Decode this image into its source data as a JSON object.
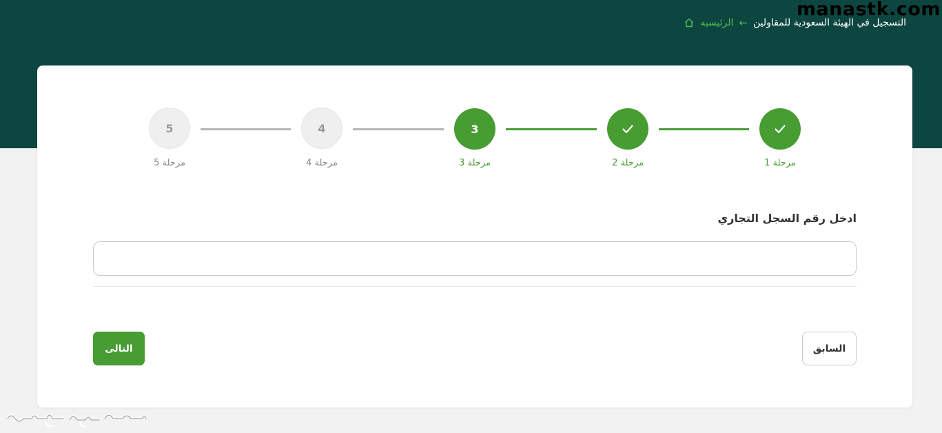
{
  "watermark": {
    "site": "manastk.com"
  },
  "breadcrumb": {
    "home_label": "الرئيسيه",
    "arrow": "←",
    "current": "التسجيل في الهيئة السعودية للمقاولين"
  },
  "stepper": {
    "steps": [
      {
        "number": "1",
        "label": "مرحلة 1",
        "status": "done"
      },
      {
        "number": "2",
        "label": "مرحلة 2",
        "status": "done"
      },
      {
        "number": "3",
        "label": "مرحلة 3",
        "status": "active"
      },
      {
        "number": "4",
        "label": "مرحلة 4",
        "status": "todo"
      },
      {
        "number": "5",
        "label": "مرحلة 5",
        "status": "todo"
      }
    ]
  },
  "form": {
    "cr_label": "ادخل رقم السجل التجاري",
    "cr_value": "",
    "cr_placeholder": ""
  },
  "actions": {
    "next_label": "التالى",
    "prev_label": "السابق"
  },
  "colors": {
    "header": "#0d4640",
    "accent": "#479c32",
    "breadcrumb_link": "#4fc14a",
    "inactive": "#efefef"
  }
}
